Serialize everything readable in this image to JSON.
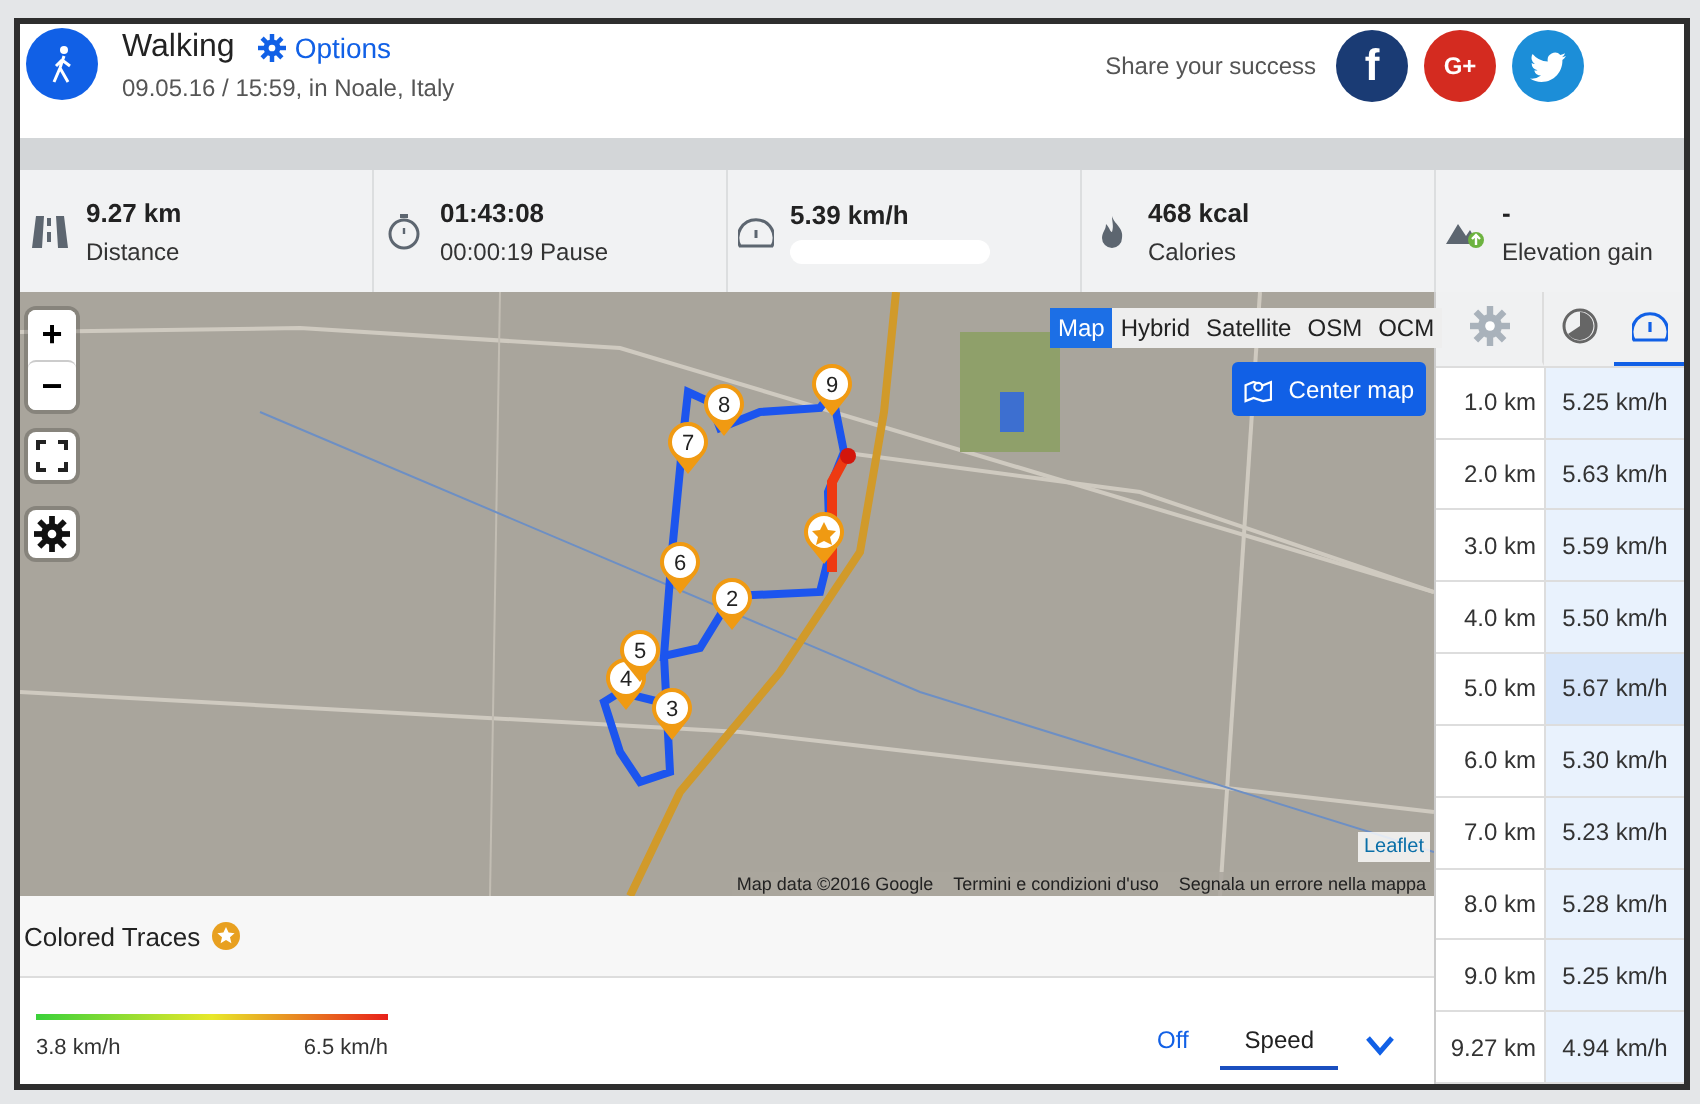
{
  "activity": {
    "title": "Walking",
    "options": "Options",
    "subtitle": "09.05.16 / 15:59, in Noale, Italy"
  },
  "share": {
    "label": "Share your success",
    "buttons": [
      {
        "kind": "facebook",
        "label": "f"
      },
      {
        "kind": "googleplus",
        "label": "G+"
      },
      {
        "kind": "twitter"
      }
    ]
  },
  "stats": [
    {
      "kind": "distance",
      "value": "9.27 km",
      "label": "Distance"
    },
    {
      "kind": "time",
      "value": "01:43:08",
      "label": "00:00:19 Pause"
    },
    {
      "kind": "speed",
      "value": "5.39 km/h",
      "redacted": true
    },
    {
      "kind": "calories",
      "value": "468 kcal",
      "label": "Calories"
    },
    {
      "kind": "elevation",
      "value": "-",
      "label": "Elevation gain"
    }
  ],
  "map": {
    "zoom_in": "+",
    "zoom_out": "−",
    "layers": [
      {
        "label": "Map",
        "selected": true
      },
      {
        "label": "Hybrid",
        "selected": false
      },
      {
        "label": "Satellite",
        "selected": false
      },
      {
        "label": "OSM",
        "selected": false
      },
      {
        "label": "OCM",
        "selected": false
      }
    ],
    "center_button": "Center map",
    "markers": [
      "2",
      "3",
      "4",
      "5",
      "6",
      "7",
      "8",
      "9"
    ],
    "leaflet": "Leaflet",
    "attribution": [
      "Map data ©2016 Google",
      "Termini e condizioni d'uso",
      "Segnala un errore nella mappa"
    ]
  },
  "colored_traces": {
    "title": "Colored Traces",
    "min": "3.8 km/h",
    "max": "6.5 km/h",
    "modes": [
      {
        "label": "Off",
        "selected": false
      },
      {
        "label": "Speed",
        "selected": true
      }
    ]
  },
  "splits": {
    "tabs": [
      {
        "kind": "settings",
        "selected": false
      },
      {
        "kind": "time",
        "selected": false
      },
      {
        "kind": "speed",
        "selected": true
      }
    ],
    "rows": [
      {
        "distance": "1.0 km",
        "value": "5.25 km/h",
        "selected": false
      },
      {
        "distance": "2.0 km",
        "value": "5.63 km/h",
        "selected": false
      },
      {
        "distance": "3.0 km",
        "value": "5.59 km/h",
        "selected": false
      },
      {
        "distance": "4.0 km",
        "value": "5.50 km/h",
        "selected": false
      },
      {
        "distance": "5.0 km",
        "value": "5.67 km/h",
        "selected": true
      },
      {
        "distance": "6.0 km",
        "value": "5.30 km/h",
        "selected": false
      },
      {
        "distance": "7.0 km",
        "value": "5.23 km/h",
        "selected": false
      },
      {
        "distance": "8.0 km",
        "value": "5.28 km/h",
        "selected": false
      },
      {
        "distance": "9.0 km",
        "value": "5.25 km/h",
        "selected": false
      },
      {
        "distance": "9.27 km",
        "value": "4.94 km/h",
        "selected": false
      }
    ]
  }
}
